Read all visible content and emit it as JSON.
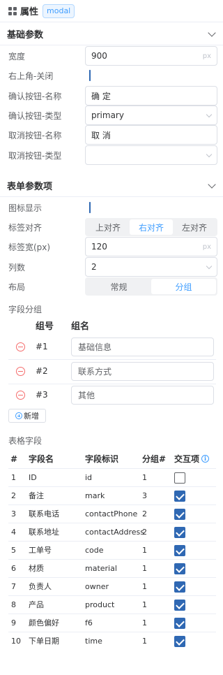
{
  "header": {
    "title": "属性",
    "tag": "modal"
  },
  "basic": {
    "title": "基础参数",
    "width_label": "宽度",
    "width_value": "900",
    "width_unit": "px",
    "close_label": "右上角-关闭",
    "ok_name_label": "确认按钮-名称",
    "ok_name_value": "确 定",
    "ok_type_label": "确认按钮-类型",
    "ok_type_value": "primary",
    "cancel_name_label": "取消按钮-名称",
    "cancel_name_value": "取 消",
    "cancel_type_label": "取消按钮-类型",
    "cancel_type_value": ""
  },
  "form": {
    "title": "表单参数项",
    "icon_label": "图标显示",
    "align_label": "标签对齐",
    "align_options": [
      "上对齐",
      "右对齐",
      "左对齐"
    ],
    "label_width_label": "标签宽(px)",
    "label_width_value": "120",
    "label_width_unit": "px",
    "cols_label": "列数",
    "cols_value": "2",
    "layout_label": "布局",
    "layout_options": [
      "常规",
      "分组"
    ]
  },
  "groups": {
    "title": "字段分组",
    "col_no": "组号",
    "col_name": "组名",
    "rows": [
      {
        "no": "#1",
        "name": "基础信息"
      },
      {
        "no": "#2",
        "name": "联系方式"
      },
      {
        "no": "#3",
        "name": "其他"
      }
    ],
    "add_label": "新增"
  },
  "fields": {
    "title": "表格字段",
    "columns": [
      "#",
      "字段名",
      "字段标识",
      "分组#",
      "交互项"
    ],
    "rows": [
      {
        "idx": "1",
        "name": "ID",
        "key": "id",
        "group": "1",
        "checked": false
      },
      {
        "idx": "2",
        "name": "备注",
        "key": "mark",
        "group": "3",
        "checked": true
      },
      {
        "idx": "3",
        "name": "联系电话",
        "key": "contactPhone",
        "group": "2",
        "checked": true
      },
      {
        "idx": "4",
        "name": "联系地址",
        "key": "contactAddress",
        "group": "2",
        "checked": true
      },
      {
        "idx": "5",
        "name": "工单号",
        "key": "code",
        "group": "1",
        "checked": true
      },
      {
        "idx": "6",
        "name": "材质",
        "key": "material",
        "group": "1",
        "checked": true
      },
      {
        "idx": "7",
        "name": "负责人",
        "key": "owner",
        "group": "1",
        "checked": true
      },
      {
        "idx": "8",
        "name": "产品",
        "key": "product",
        "group": "1",
        "checked": true
      },
      {
        "idx": "9",
        "name": "颜色偏好",
        "key": "f6",
        "group": "1",
        "checked": true
      },
      {
        "idx": "10",
        "name": "下单日期",
        "key": "time",
        "group": "1",
        "checked": true
      }
    ]
  },
  "colors": {
    "accent": "#409eff",
    "check": "#2f68b3",
    "danger": "#f56c6c"
  }
}
